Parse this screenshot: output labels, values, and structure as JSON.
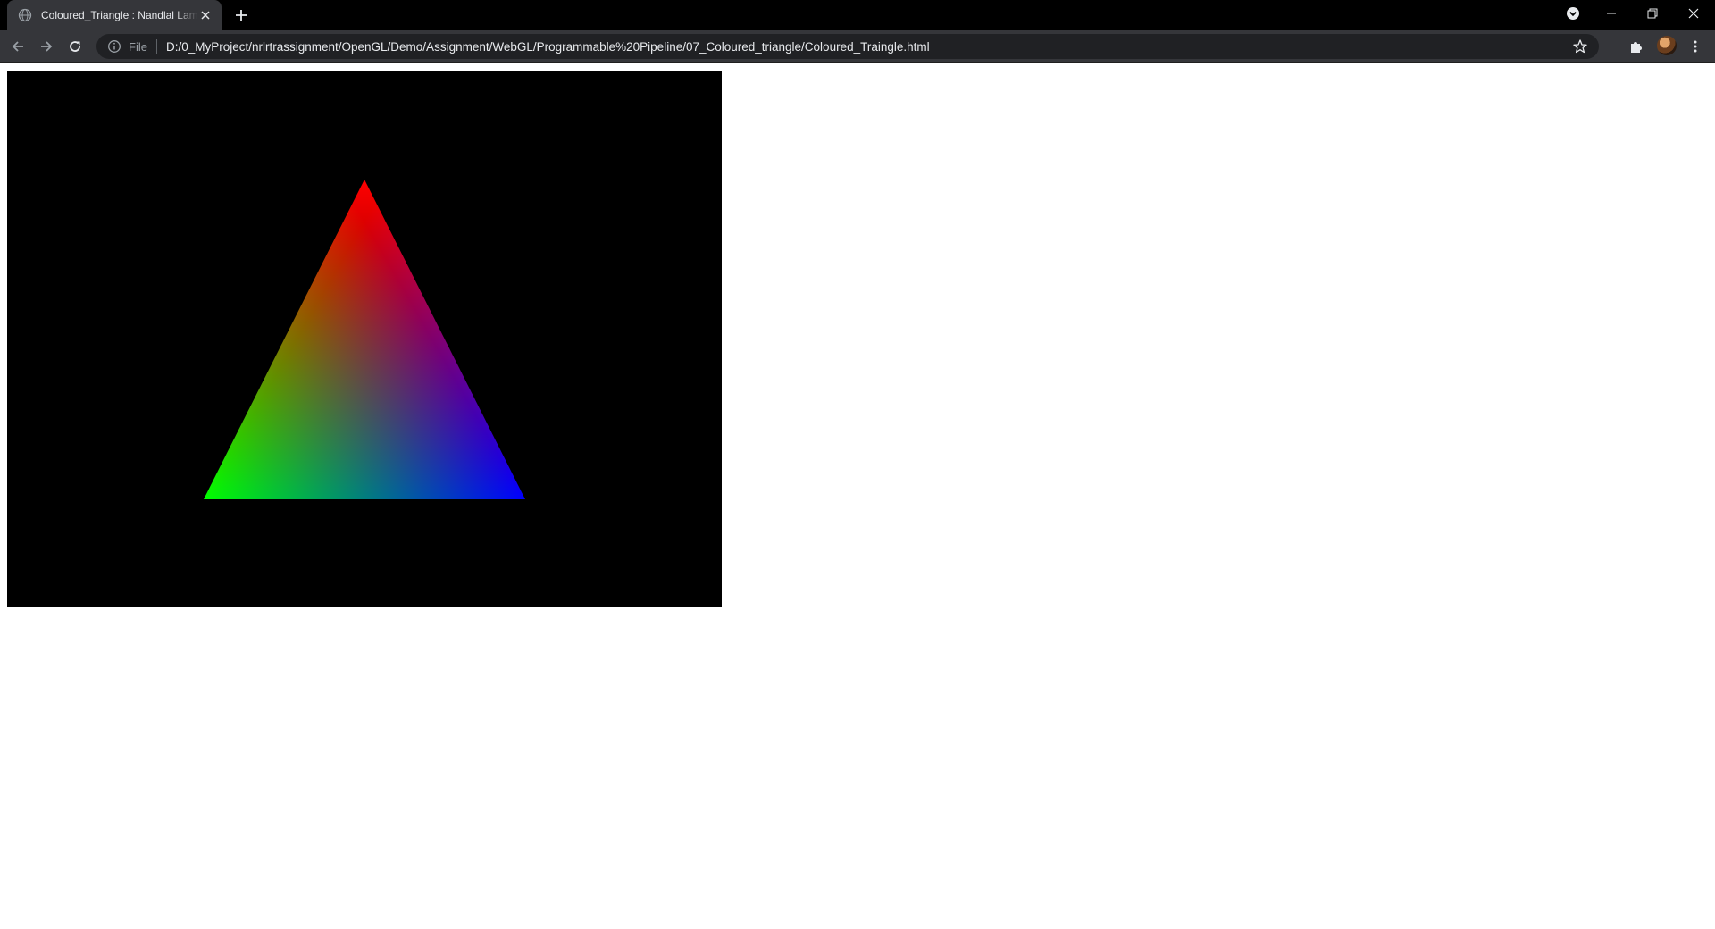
{
  "browser": {
    "tab": {
      "title": "Coloured_Triangle : Nandlal Lamb",
      "favicon": "globe-icon"
    },
    "address_bar": {
      "scheme_label": "File",
      "url": "D:/0_MyProject/nrlrtrassignment/OpenGL/Demo/Assignment/WebGL/Programmable%20Pipeline/07_Coloured_triangle/Coloured_Traingle.html"
    },
    "colors": {
      "frame": "#000000",
      "toolbar": "#35363a",
      "omnibox": "#202124",
      "text": "#e8eaed"
    }
  },
  "canvas": {
    "background": "#000000",
    "triangle": {
      "top_color": "#ff0000",
      "left_color": "#00ff00",
      "right_color": "#0000ff"
    }
  }
}
